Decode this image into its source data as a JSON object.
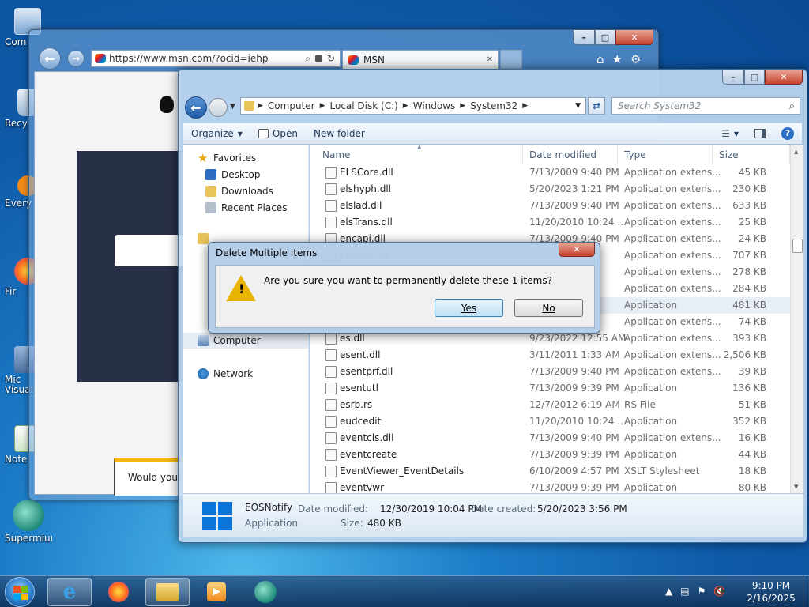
{
  "desktop": {
    "icons": [
      {
        "label": "Com",
        "icon": "computer-icon"
      },
      {
        "label": "Recy",
        "icon": "recycle-bin-icon"
      },
      {
        "label": "Every",
        "icon": "everything-icon"
      },
      {
        "label": "Fir",
        "icon": "firefox-icon"
      },
      {
        "label": "Mic Visual",
        "icon": "visual-studio-icon"
      },
      {
        "label": "Note",
        "icon": "notepad-icon"
      },
      {
        "label": "Supermium",
        "icon": "supermium-icon"
      }
    ]
  },
  "browser": {
    "url": "https://www.msn.com/?ocid=iehp",
    "tab_title": "MSN",
    "banner_text": "Would you l",
    "minimize": "–",
    "maximize": "□",
    "close": "✕"
  },
  "explorer": {
    "breadcrumb": [
      "Computer",
      "Local Disk (C:)",
      "Windows",
      "System32"
    ],
    "search_placeholder": "Search System32",
    "toolbar": {
      "organize": "Organize",
      "open": "Open",
      "new_folder": "New folder"
    },
    "nav": {
      "favorites": "Favorites",
      "desktop": "Desktop",
      "downloads": "Downloads",
      "recent_places": "Recent Places",
      "computer": "Computer",
      "network": "Network"
    },
    "columns": {
      "name": "Name",
      "date_modified": "Date modified",
      "type": "Type",
      "size": "Size"
    },
    "files": [
      {
        "name": "ELSCore.dll",
        "date": "7/13/2009 9:40 PM",
        "type": "Application extens...",
        "size": "45 KB"
      },
      {
        "name": "elshyph.dll",
        "date": "5/20/2023 1:21 PM",
        "type": "Application extens...",
        "size": "230 KB"
      },
      {
        "name": "elslad.dll",
        "date": "7/13/2009 9:40 PM",
        "type": "Application extens...",
        "size": "633 KB"
      },
      {
        "name": "elsTrans.dll",
        "date": "11/20/2010 10:24 ...",
        "type": "Application extens...",
        "size": "25 KB"
      },
      {
        "name": "encapi.dll",
        "date": "7/13/2009 9:40 PM",
        "type": "Application extens...",
        "size": "24 KB"
      },
      {
        "name": "EncDec.dll",
        "date": "",
        "type": "Application extens...",
        "size": "707 KB"
      },
      {
        "name": "",
        "date": "PM",
        "type": "Application extens...",
        "size": "278 KB"
      },
      {
        "name": "",
        "date": "PM",
        "type": "Application extens...",
        "size": "284 KB"
      },
      {
        "name": "",
        "date": "",
        "type": "Application",
        "size": "481 KB"
      },
      {
        "name": "",
        "date": "",
        "type": "Application extens...",
        "size": "74 KB"
      },
      {
        "name": "es.dll",
        "date": "9/23/2022 12:55 AM",
        "type": "Application extens...",
        "size": "393 KB"
      },
      {
        "name": "esent.dll",
        "date": "3/11/2011 1:33 AM",
        "type": "Application extens...",
        "size": "2,506 KB"
      },
      {
        "name": "esentprf.dll",
        "date": "7/13/2009 9:40 PM",
        "type": "Application extens...",
        "size": "39 KB"
      },
      {
        "name": "esentutl",
        "date": "7/13/2009 9:39 PM",
        "type": "Application",
        "size": "136 KB"
      },
      {
        "name": "esrb.rs",
        "date": "12/7/2012 6:19 AM",
        "type": "RS File",
        "size": "51 KB"
      },
      {
        "name": "eudcedit",
        "date": "11/20/2010 10:24 ...",
        "type": "Application",
        "size": "352 KB"
      },
      {
        "name": "eventcls.dll",
        "date": "7/13/2009 9:40 PM",
        "type": "Application extens...",
        "size": "16 KB"
      },
      {
        "name": "eventcreate",
        "date": "7/13/2009 9:39 PM",
        "type": "Application",
        "size": "44 KB"
      },
      {
        "name": "EventViewer_EventDetails",
        "date": "6/10/2009 4:57 PM",
        "type": "XSLT Stylesheet",
        "size": "18 KB"
      },
      {
        "name": "eventvwr",
        "date": "7/13/2009 9:39 PM",
        "type": "Application",
        "size": "80 KB"
      }
    ],
    "details": {
      "name": "EOSNotify",
      "kind": "Application",
      "date_modified_label": "Date modified:",
      "date_modified": "12/30/2019 10:04 PM",
      "date_created_label": "Date created:",
      "date_created": "5/20/2023 3:56 PM",
      "size_label": "Size:",
      "size": "480 KB"
    }
  },
  "dialog": {
    "title": "Delete Multiple Items",
    "message": "Are you sure you want to permanently delete these 1 items?",
    "yes": "Yes",
    "no": "No"
  },
  "taskbar": {
    "time": "9:10 PM",
    "date": "2/16/2025",
    "apps": [
      "start-orb",
      "internet-explorer",
      "firefox",
      "windows-explorer",
      "media-player",
      "supermium"
    ]
  }
}
